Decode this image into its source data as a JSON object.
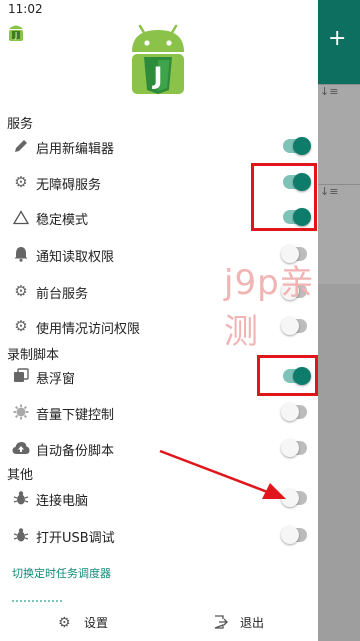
{
  "statusbar": {
    "time": "11:02"
  },
  "sections": {
    "services": "服务",
    "recording": "录制脚本",
    "other": "其他"
  },
  "items": [
    {
      "label": "启用新编辑器",
      "icon": "pencil-icon",
      "on": true
    },
    {
      "label": "无障碍服务",
      "icon": "gear-icon",
      "on": true
    },
    {
      "label": "稳定模式",
      "icon": "triangle-icon",
      "on": true
    },
    {
      "label": "通知读取权限",
      "icon": "bell-icon",
      "on": false
    },
    {
      "label": "前台服务",
      "icon": "gear-icon",
      "on": false
    },
    {
      "label": "使用情况访问权限",
      "icon": "gear-icon",
      "on": false
    },
    {
      "label": "悬浮窗",
      "icon": "window-icon",
      "on": true
    },
    {
      "label": "音量下键控制",
      "icon": "cog-icon",
      "on": false
    },
    {
      "label": "自动备份脚本",
      "icon": "cloud-upload-icon",
      "on": false
    },
    {
      "label": "连接电脑",
      "icon": "bug-icon",
      "on": false
    },
    {
      "label": "打开USB调试",
      "icon": "bug-icon",
      "on": false
    }
  ],
  "links": {
    "switch_scheduler": "切换定时任务调度器"
  },
  "bottom": {
    "settings": "设置",
    "exit": "退出"
  },
  "watermark": "j9p亲测",
  "colors": {
    "accent": "#0e7c6b",
    "track_on": "#7fc3b8",
    "annotation": "#e0161d"
  }
}
